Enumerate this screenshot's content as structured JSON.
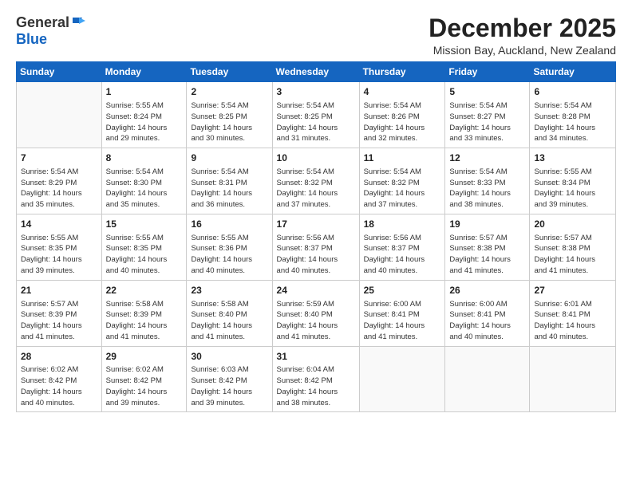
{
  "logo": {
    "general": "General",
    "blue": "Blue"
  },
  "header": {
    "month": "December 2025",
    "location": "Mission Bay, Auckland, New Zealand"
  },
  "weekdays": [
    "Sunday",
    "Monday",
    "Tuesday",
    "Wednesday",
    "Thursday",
    "Friday",
    "Saturday"
  ],
  "weeks": [
    [
      {
        "day": "",
        "info": ""
      },
      {
        "day": "1",
        "info": "Sunrise: 5:55 AM\nSunset: 8:24 PM\nDaylight: 14 hours\nand 29 minutes."
      },
      {
        "day": "2",
        "info": "Sunrise: 5:54 AM\nSunset: 8:25 PM\nDaylight: 14 hours\nand 30 minutes."
      },
      {
        "day": "3",
        "info": "Sunrise: 5:54 AM\nSunset: 8:25 PM\nDaylight: 14 hours\nand 31 minutes."
      },
      {
        "day": "4",
        "info": "Sunrise: 5:54 AM\nSunset: 8:26 PM\nDaylight: 14 hours\nand 32 minutes."
      },
      {
        "day": "5",
        "info": "Sunrise: 5:54 AM\nSunset: 8:27 PM\nDaylight: 14 hours\nand 33 minutes."
      },
      {
        "day": "6",
        "info": "Sunrise: 5:54 AM\nSunset: 8:28 PM\nDaylight: 14 hours\nand 34 minutes."
      }
    ],
    [
      {
        "day": "7",
        "info": "Sunrise: 5:54 AM\nSunset: 8:29 PM\nDaylight: 14 hours\nand 35 minutes."
      },
      {
        "day": "8",
        "info": "Sunrise: 5:54 AM\nSunset: 8:30 PM\nDaylight: 14 hours\nand 35 minutes."
      },
      {
        "day": "9",
        "info": "Sunrise: 5:54 AM\nSunset: 8:31 PM\nDaylight: 14 hours\nand 36 minutes."
      },
      {
        "day": "10",
        "info": "Sunrise: 5:54 AM\nSunset: 8:32 PM\nDaylight: 14 hours\nand 37 minutes."
      },
      {
        "day": "11",
        "info": "Sunrise: 5:54 AM\nSunset: 8:32 PM\nDaylight: 14 hours\nand 37 minutes."
      },
      {
        "day": "12",
        "info": "Sunrise: 5:54 AM\nSunset: 8:33 PM\nDaylight: 14 hours\nand 38 minutes."
      },
      {
        "day": "13",
        "info": "Sunrise: 5:55 AM\nSunset: 8:34 PM\nDaylight: 14 hours\nand 39 minutes."
      }
    ],
    [
      {
        "day": "14",
        "info": "Sunrise: 5:55 AM\nSunset: 8:35 PM\nDaylight: 14 hours\nand 39 minutes."
      },
      {
        "day": "15",
        "info": "Sunrise: 5:55 AM\nSunset: 8:35 PM\nDaylight: 14 hours\nand 40 minutes."
      },
      {
        "day": "16",
        "info": "Sunrise: 5:55 AM\nSunset: 8:36 PM\nDaylight: 14 hours\nand 40 minutes."
      },
      {
        "day": "17",
        "info": "Sunrise: 5:56 AM\nSunset: 8:37 PM\nDaylight: 14 hours\nand 40 minutes."
      },
      {
        "day": "18",
        "info": "Sunrise: 5:56 AM\nSunset: 8:37 PM\nDaylight: 14 hours\nand 40 minutes."
      },
      {
        "day": "19",
        "info": "Sunrise: 5:57 AM\nSunset: 8:38 PM\nDaylight: 14 hours\nand 41 minutes."
      },
      {
        "day": "20",
        "info": "Sunrise: 5:57 AM\nSunset: 8:38 PM\nDaylight: 14 hours\nand 41 minutes."
      }
    ],
    [
      {
        "day": "21",
        "info": "Sunrise: 5:57 AM\nSunset: 8:39 PM\nDaylight: 14 hours\nand 41 minutes."
      },
      {
        "day": "22",
        "info": "Sunrise: 5:58 AM\nSunset: 8:39 PM\nDaylight: 14 hours\nand 41 minutes."
      },
      {
        "day": "23",
        "info": "Sunrise: 5:58 AM\nSunset: 8:40 PM\nDaylight: 14 hours\nand 41 minutes."
      },
      {
        "day": "24",
        "info": "Sunrise: 5:59 AM\nSunset: 8:40 PM\nDaylight: 14 hours\nand 41 minutes."
      },
      {
        "day": "25",
        "info": "Sunrise: 6:00 AM\nSunset: 8:41 PM\nDaylight: 14 hours\nand 41 minutes."
      },
      {
        "day": "26",
        "info": "Sunrise: 6:00 AM\nSunset: 8:41 PM\nDaylight: 14 hours\nand 40 minutes."
      },
      {
        "day": "27",
        "info": "Sunrise: 6:01 AM\nSunset: 8:41 PM\nDaylight: 14 hours\nand 40 minutes."
      }
    ],
    [
      {
        "day": "28",
        "info": "Sunrise: 6:02 AM\nSunset: 8:42 PM\nDaylight: 14 hours\nand 40 minutes."
      },
      {
        "day": "29",
        "info": "Sunrise: 6:02 AM\nSunset: 8:42 PM\nDaylight: 14 hours\nand 39 minutes."
      },
      {
        "day": "30",
        "info": "Sunrise: 6:03 AM\nSunset: 8:42 PM\nDaylight: 14 hours\nand 39 minutes."
      },
      {
        "day": "31",
        "info": "Sunrise: 6:04 AM\nSunset: 8:42 PM\nDaylight: 14 hours\nand 38 minutes."
      },
      {
        "day": "",
        "info": ""
      },
      {
        "day": "",
        "info": ""
      },
      {
        "day": "",
        "info": ""
      }
    ]
  ]
}
